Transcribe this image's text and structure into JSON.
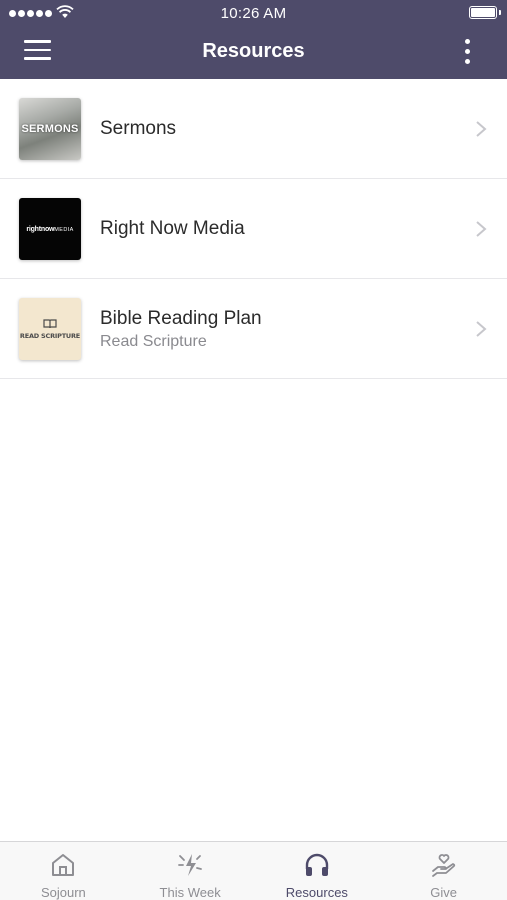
{
  "status_bar": {
    "time": "10:26 AM"
  },
  "nav": {
    "title": "Resources",
    "menu_icon": "hamburger-icon",
    "more_icon": "vertical-dots-icon"
  },
  "colors": {
    "header_bg": "#4e4b6a",
    "active_tab": "#4e4b6a",
    "inactive_tab": "#8e8e93"
  },
  "resources": [
    {
      "title": "Sermons",
      "subtitle": "",
      "thumb_text": "SERMONS"
    },
    {
      "title": "Right Now Media",
      "subtitle": "",
      "thumb_text_bold": "rightnow",
      "thumb_text_light": "MEDIA"
    },
    {
      "title": "Bible Reading Plan",
      "subtitle": "Read Scripture",
      "thumb_text": "READ SCRIPTURE"
    }
  ],
  "tabs": [
    {
      "label": "Sojourn",
      "icon": "home-icon",
      "active": false
    },
    {
      "label": "This Week",
      "icon": "sparkle-bolt-icon",
      "active": false
    },
    {
      "label": "Resources",
      "icon": "headphones-icon",
      "active": true
    },
    {
      "label": "Give",
      "icon": "hand-heart-icon",
      "active": false
    }
  ]
}
